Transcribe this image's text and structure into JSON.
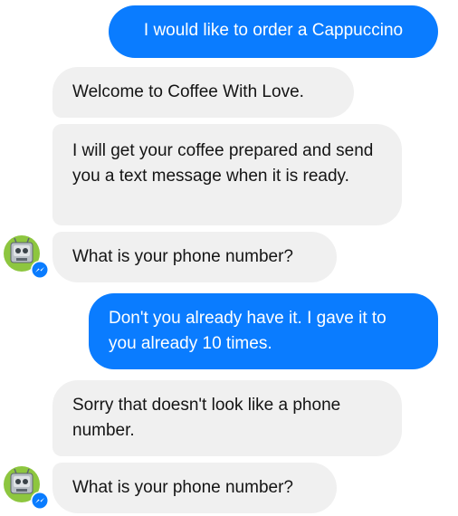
{
  "messages": [
    {
      "id": "m1",
      "sender": "user",
      "text": "I would like to order a Cappuccino"
    },
    {
      "id": "m2",
      "sender": "bot",
      "text": "Welcome to Coffee With Love."
    },
    {
      "id": "m3",
      "sender": "bot",
      "text": "I will get your coffee prepared and send you a text message when it is ready."
    },
    {
      "id": "m4",
      "sender": "bot",
      "text": "What is your phone number?"
    },
    {
      "id": "m5",
      "sender": "user",
      "text": "Don't you already have it. I gave it to you already 10 times."
    },
    {
      "id": "m6",
      "sender": "bot",
      "text": "Sorry that doesn't look like a phone number."
    },
    {
      "id": "m7",
      "sender": "bot",
      "text": "What is your phone number?"
    }
  ],
  "colors": {
    "outgoing_bubble": "#0a7cff",
    "incoming_bubble": "#f0f0f0",
    "avatar_bg": "#8dc63f",
    "messenger_badge": "#0a7cff"
  },
  "icons": {
    "bot_avatar": "robot-avatar-icon",
    "badge": "messenger-badge-icon"
  }
}
